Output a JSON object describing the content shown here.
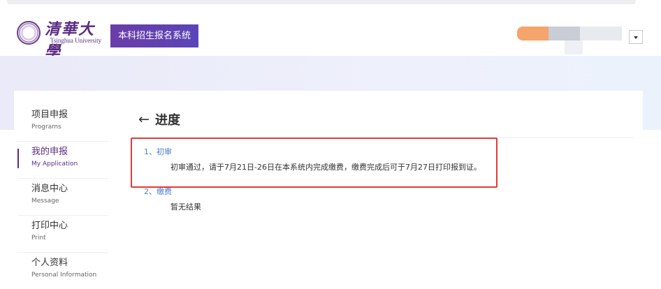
{
  "header": {
    "logo_cn": "清華大學",
    "logo_en": "Tsinghua University",
    "system_title": "本科招生报名系统"
  },
  "sidebar": {
    "items": [
      {
        "cn": "项目申报",
        "en": "Programs"
      },
      {
        "cn": "我的申报",
        "en": "My Application"
      },
      {
        "cn": "消息中心",
        "en": "Message"
      },
      {
        "cn": "打印中心",
        "en": "Print"
      },
      {
        "cn": "个人资料",
        "en": "Personal Information"
      }
    ]
  },
  "main": {
    "back_arrow": "←",
    "title": "进度",
    "steps": [
      {
        "head": "1、初审",
        "body": "初审通过，请于7月21日-26日在本系统内完成缴费，缴费完成后可于7月27日打印报到证。"
      },
      {
        "head": "2、缴费",
        "body": "暂无结果"
      }
    ]
  },
  "colors": {
    "brand": "#5b2c83",
    "link": "#4a7fd6",
    "highlight": "#e53935"
  }
}
